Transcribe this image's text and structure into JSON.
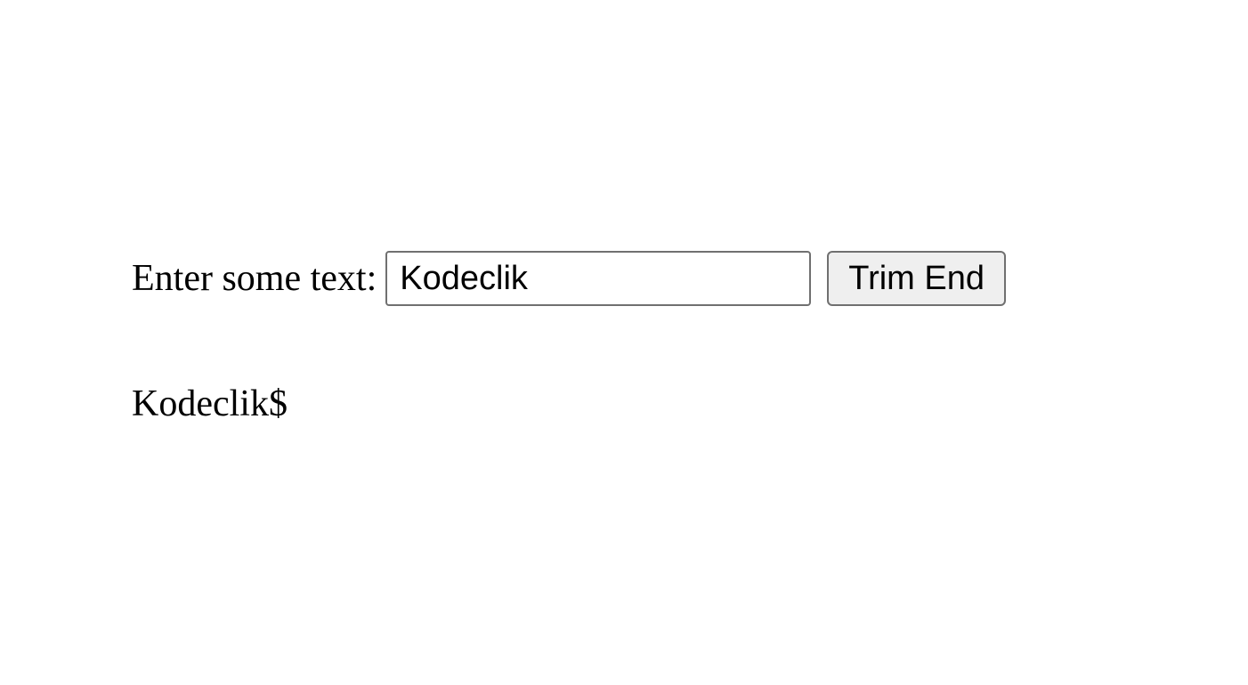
{
  "form": {
    "label": "Enter some text: ",
    "input_value": "Kodeclik",
    "button_label": "Trim End"
  },
  "output": {
    "text": "Kodeclik$"
  }
}
